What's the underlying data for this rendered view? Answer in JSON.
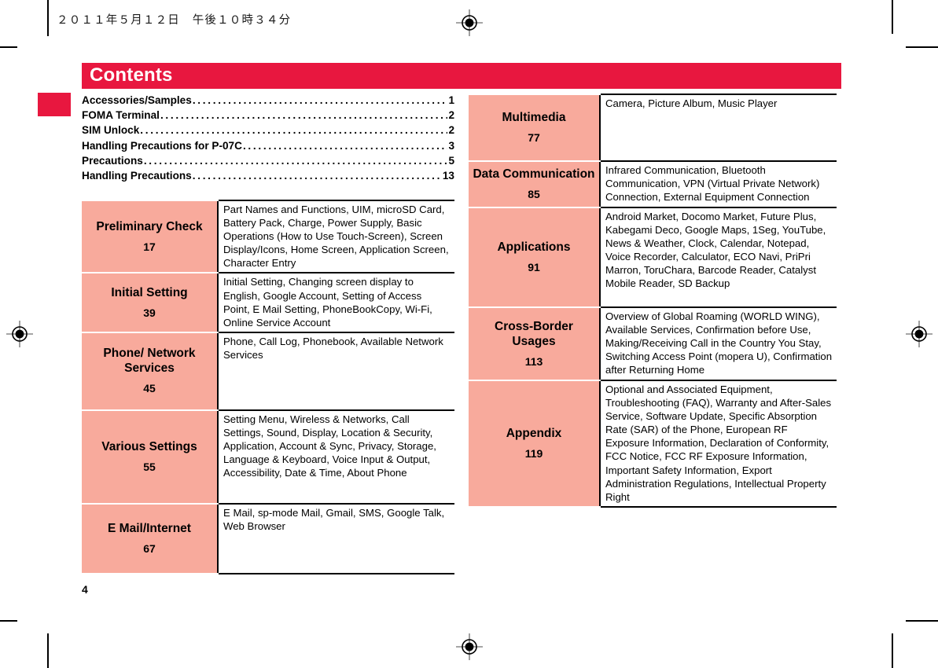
{
  "running_head": "２０１１年５月１２日　午後１０時３４分",
  "page_number": "4",
  "colors": {
    "banner_red": "#e8173f",
    "chapter_pink": "#f8aa9c",
    "text_black": "#000000"
  },
  "banner": {
    "title": "Contents"
  },
  "toc": [
    {
      "title": "Accessories/Samples",
      "page": "1"
    },
    {
      "title": "FOMA Terminal",
      "page": "2"
    },
    {
      "title": "SIM Unlock",
      "page": "2"
    },
    {
      "title": "Handling Precautions for P-07C",
      "page": "3"
    },
    {
      "title": "Precautions",
      "page": "5"
    },
    {
      "title": "Handling Precautions",
      "page": "13"
    }
  ],
  "chapters_left": [
    {
      "name": "Preliminary Check",
      "page": "17",
      "desc": "Part Names and Functions, UIM, microSD Card, Battery Pack, Charge, Power Supply, Basic Operations (How to Use Touch-Screen), Screen Display/Icons, Home Screen, Application Screen, Character Entry"
    },
    {
      "name": "Initial Setting",
      "page": "39",
      "desc": "Initial Setting, Changing screen display to English, Google Account, Setting of Access Point, E Mail Setting, PhoneBookCopy, Wi-Fi, Online Service Account"
    },
    {
      "name": "Phone/ Network Services",
      "page": "45",
      "desc": "Phone, Call Log, Phonebook, Available Network Services"
    },
    {
      "name": "Various Settings",
      "page": "55",
      "desc": "Setting Menu, Wireless & Networks, Call Settings, Sound, Display, Location & Security, Application, Account & Sync, Privacy, Storage, Language & Keyboard, Voice Input & Output, Accessibility, Date & Time, About Phone"
    },
    {
      "name": "E Mail/Internet",
      "page": "67",
      "desc": "E Mail, sp-mode Mail, Gmail, SMS, Google Talk, Web Browser"
    }
  ],
  "chapters_right": [
    {
      "name": "Multimedia",
      "page": "77",
      "desc": "Camera, Picture Album, Music Player"
    },
    {
      "name": "Data Communication",
      "page": "85",
      "desc": "Infrared Communication, Bluetooth Communication, VPN (Virtual Private Network) Connection, External Equipment Connection"
    },
    {
      "name": "Applications",
      "page": "91",
      "desc": "Android Market, Docomo Market, Future Plus, Kabegami Deco, Google Maps, 1Seg, YouTube, News & Weather, Clock, Calendar, Notepad, Voice Recorder, Calculator, ECO Navi, PriPri Marron, ToruChara, Barcode Reader, Catalyst Mobile Reader, SD Backup"
    },
    {
      "name": "Cross-Border Usages",
      "page": "113",
      "desc": "Overview of Global Roaming (WORLD WING), Available Services, Confirmation before Use, Making/Receiving Call in the Country You Stay, Switching Access Point (mopera U), Confirmation after Returning Home"
    },
    {
      "name": "Appendix",
      "page": "119",
      "desc": "Optional and Associated Equipment, Troubleshooting (FAQ), Warranty and After-Sales Service, Software Update, Specific Absorption Rate (SAR) of the Phone, European RF Exposure Information, Declaration of Conformity, FCC Notice, FCC RF Exposure Information, Important Safety Information, Export Administration Regulations, Intellectual Property Right"
    }
  ]
}
